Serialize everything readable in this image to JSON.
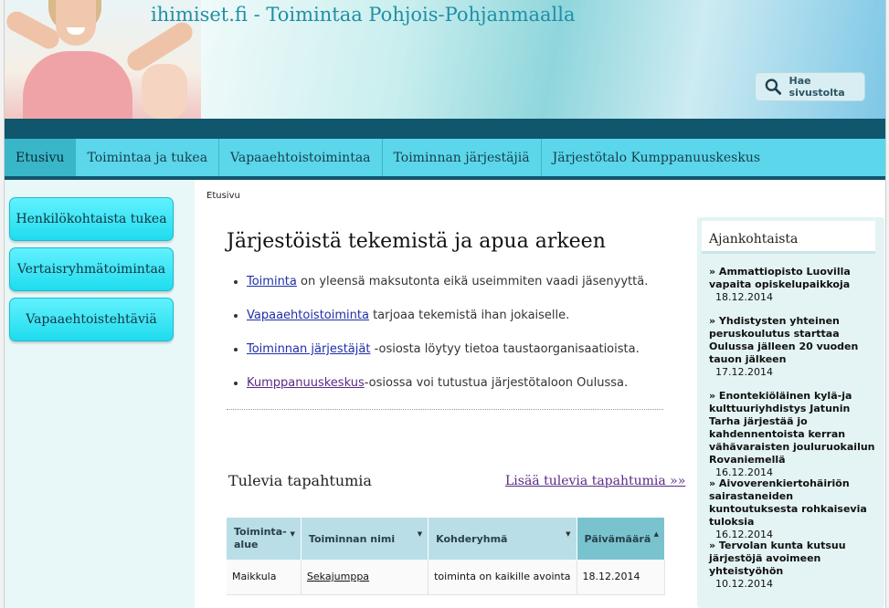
{
  "header": {
    "site_title": "ihimiset.fi - Toimintaa Pohjois-Pohjanmaalla",
    "search_label": "Hae sivustolta"
  },
  "nav": {
    "items": [
      {
        "label": "Etusivu",
        "active": true
      },
      {
        "label": "Toimintaa ja tukea"
      },
      {
        "label": "Vapaaehtoistoimintaa"
      },
      {
        "label": "Toiminnan järjestäjiä"
      },
      {
        "label": "Järjestötalo Kumppanuuskeskus"
      }
    ]
  },
  "sidebar": {
    "buttons": [
      {
        "label": "Henkilökohtaista tukea"
      },
      {
        "label": "Vertaisryhmätoimintaa"
      },
      {
        "label": "Vapaaehtoistehtäviä"
      }
    ]
  },
  "main": {
    "breadcrumb": "Etusivu",
    "heading": "Järjestöistä tekemistä ja apua arkeen",
    "intro": [
      {
        "link": "Toiminta",
        "text": " on yleensä maksutonta eikä useimmiten vaadi jäsenyyttä."
      },
      {
        "link": "Vapaaehtoistoiminta",
        "text": " tarjoaa tekemistä ihan jokaiselle."
      },
      {
        "link": "Toiminnan järjestäjät",
        "text": " -osiosta löytyy tietoa taustaorganisaatioista."
      },
      {
        "link": "Kumppanuuskeskus",
        "text": "-osiossa voi tutustua järjestötaloon Oulussa."
      }
    ],
    "events_title": "Tulevia tapahtumia",
    "events_more": "Lisää tulevia tapahtumia »»",
    "table": {
      "headers": [
        "Toiminta-alue",
        "Toiminnan nimi",
        "Kohderyhmä",
        "Päivämäärä"
      ],
      "rows": [
        [
          "Maikkula",
          "Sekajumppa",
          "toiminta on kaikille avointa",
          "18.12.2014"
        ]
      ]
    }
  },
  "news": {
    "heading": "Ajankohtaista",
    "items": [
      {
        "title": "» Ammattiopisto Luovilla vapaita opiskelupaikkoja",
        "date": "18.12.2014"
      },
      {
        "title": "» Yhdistysten yhteinen peruskoulutus starttaa Oulussa jälleen 20 vuoden tauon jälkeen",
        "date": "17.12.2014"
      },
      {
        "title": "» Enontekiöläinen kylä-ja kulttuuriyhdistys Jatunin Tarha järjestää jo kahdennentoista kerran vähävaraisten jouluruokailun Rovaniemellä",
        "date": "16.12.2014"
      },
      {
        "title": "» Aivoverenkiertohäiriön sairastaneiden kuntoutuksesta rohkaisevia tuloksia",
        "date": "16.12.2014"
      },
      {
        "title": "» Tervolan kunta kutsuu järjestöjä avoimeen yhteistyöhön",
        "date": "10.12.2014"
      }
    ]
  }
}
